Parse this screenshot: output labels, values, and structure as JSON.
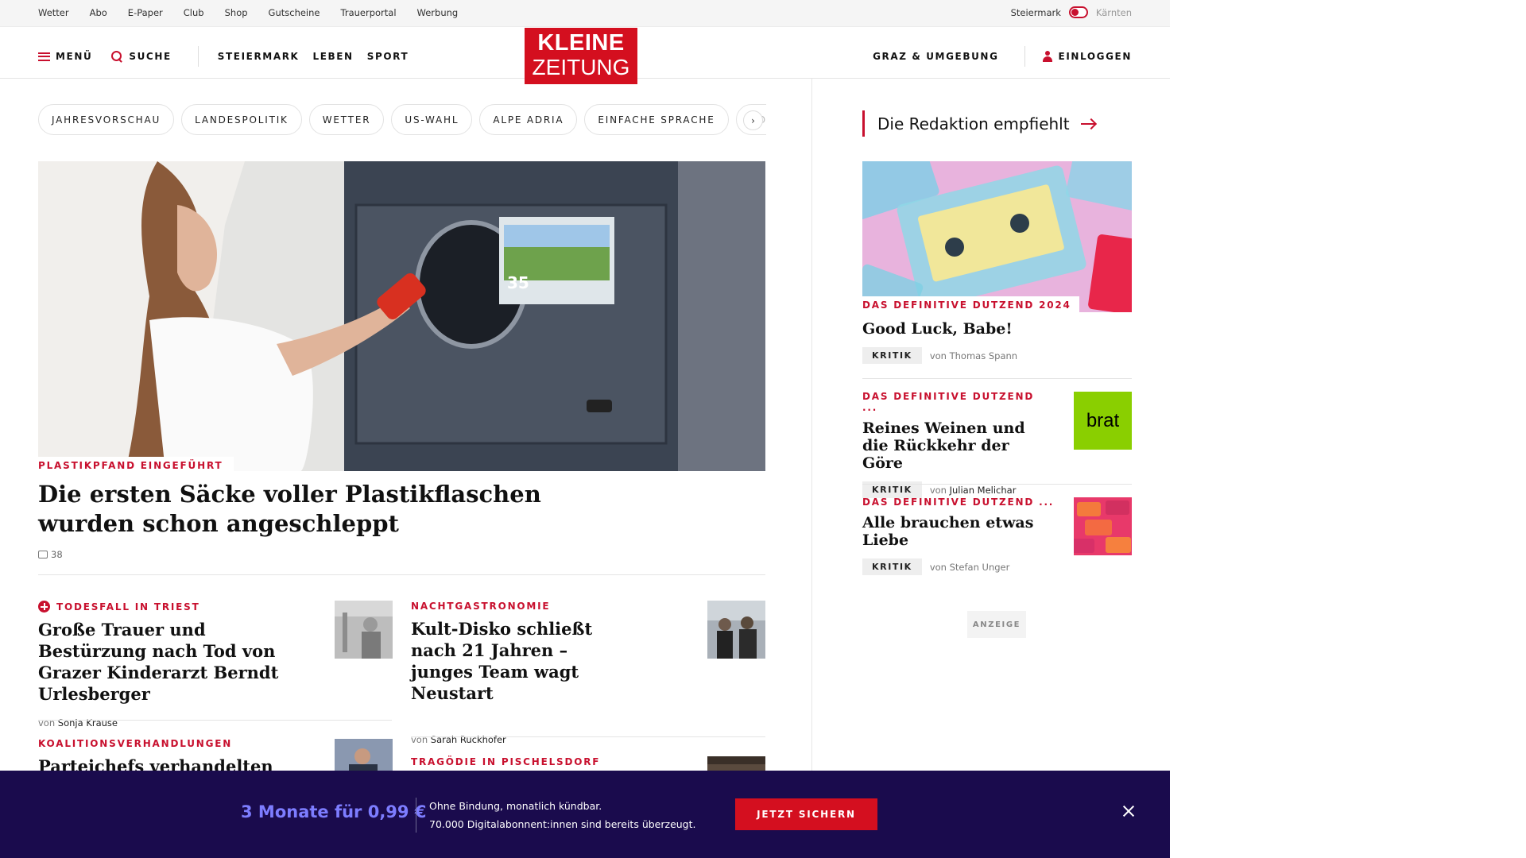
{
  "utility_bar": {
    "links": [
      "Wetter",
      "Abo",
      "E-Paper",
      "Club",
      "Shop",
      "Gutscheine",
      "Trauerportal",
      "Werbung"
    ],
    "region_active": "Steiermark",
    "region_inactive": "Kärnten"
  },
  "header": {
    "menu_label": "MENÜ",
    "search_label": "SUCHE",
    "sections": [
      "STEIERMARK",
      "LEBEN",
      "SPORT"
    ],
    "logo_line1": "KLEINE",
    "logo_line2": "ZEITUNG",
    "local_label": "GRAZ & UMGEBUNG",
    "login_label": "EINLOGGEN"
  },
  "topics": [
    "JAHRESVORSCHAU",
    "LANDESPOLITIK",
    "WETTER",
    "US-WAHL",
    "ALPE ADRIA",
    "EINFACHE SPRACHE",
    "DOS"
  ],
  "hero": {
    "kicker": "PLASTIKPFAND EINGEFÜHRT",
    "title": "Die ersten Säcke voller Plastikflaschen wurden schon angeschleppt",
    "comments": "38"
  },
  "articles": [
    {
      "kicker": "TODESFALL IN TRIEST",
      "title": "Große Trauer und Bestürzung nach Tod von Grazer Kinderarzt Berndt Urlesberger",
      "by_prefix": "von",
      "author": "Sonja Krause"
    },
    {
      "kicker": "NACHTGASTRONOMIE",
      "title": "Kult-Disko schließt nach 21 Jahren – junges Team wagt Neustart",
      "by_prefix": "von",
      "author": "Sarah Ruckhofer"
    },
    {
      "kicker": "KOALITIONSVERHANDLUNGEN",
      "title": "Parteichefs verhandelten"
    },
    {
      "kicker": "TRAGÖDIE IN PISCHELSDORF"
    }
  ],
  "sidebar": {
    "heading": "Die Redaktion empfiehlt",
    "items": [
      {
        "kicker": "DAS DEFINITIVE DUTZEND 2024",
        "title": "Good Luck, Babe!",
        "tag": "KRITIK",
        "by_prefix": "von",
        "author": "Thomas Spann"
      },
      {
        "kicker": "DAS DEFINITIVE DUTZEND ...",
        "title": "Reines Weinen und die Rückkehr der Göre",
        "tag": "KRITIK",
        "by_prefix": "von",
        "author": "Julian Melichar",
        "thumb_text": "brat"
      },
      {
        "kicker": "DAS DEFINITIVE DUTZEND ...",
        "title": "Alle brauchen etwas Liebe",
        "tag": "KRITIK",
        "by_prefix": "von",
        "author": "Stefan Unger"
      }
    ],
    "ad_label": "ANZEIGE"
  },
  "banner": {
    "price": "3 Monate für 0,99 €",
    "line1": "Ohne Bindung, monatlich kündbar.",
    "line2": "70.000 Digitalabonnent:innen sind bereits überzeugt.",
    "cta": "JETZT SICHERN"
  },
  "colors": {
    "brand_red": "#d40f1f",
    "kicker_red": "#c8102e",
    "banner_bg": "#1a0b4d",
    "price_blue": "#7d7dff",
    "brat_green": "#8acf00"
  },
  "icons": {
    "menu": "hamburger-icon",
    "search": "search-icon",
    "login": "user-icon",
    "comments": "comment-icon",
    "next": "chevron-right-icon",
    "close": "close-icon",
    "recommend_arrow": "arrow-right-icon"
  }
}
